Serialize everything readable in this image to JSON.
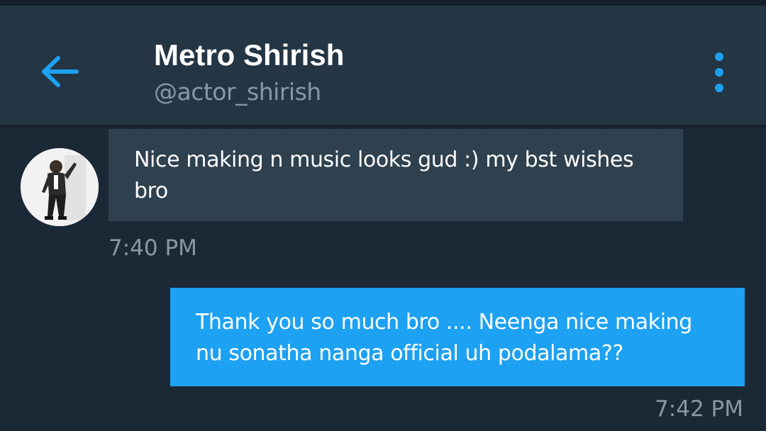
{
  "header": {
    "name": "Metro Shirish",
    "handle": "@actor_shirish",
    "back_icon": "arrow-left-icon",
    "more_icon": "more-vertical-icon"
  },
  "messages": [
    {
      "direction": "received",
      "text": "Nice making n music looks gud :) my bst wishes bro",
      "time": "7:40 PM"
    },
    {
      "direction": "sent",
      "text": "Thank you so much bro .... Neenga nice making nu sonatha nanga official uh podalama??",
      "time": "7:42 PM"
    }
  ],
  "colors": {
    "background": "#1b2836",
    "header": "#243544",
    "received_bubble": "#2f404f",
    "sent_bubble": "#1da1f2",
    "accent": "#1da1f2",
    "muted_text": "#8899a6"
  }
}
